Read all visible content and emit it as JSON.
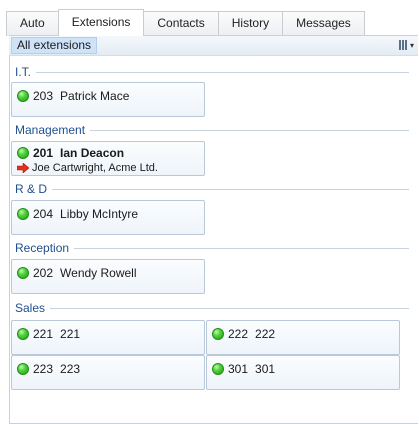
{
  "tabs": [
    {
      "label": "Auto",
      "active": false
    },
    {
      "label": "Extensions",
      "active": true
    },
    {
      "label": "Contacts",
      "active": false
    },
    {
      "label": "History",
      "active": false
    },
    {
      "label": "Messages",
      "active": false
    }
  ],
  "filter": {
    "label": "All extensions",
    "view_menu_icon": "column-view-icon"
  },
  "colors": {
    "group_title": "#1f4f8f",
    "status_available": "#3cc22c",
    "incoming_call_arrow": "#e0301e",
    "card_border": "#b9c9da",
    "filter_chip": "#cfe3f8"
  },
  "groups": [
    {
      "title": "I.T.",
      "extensions": [
        {
          "number": "203",
          "name": "Patrick Mace",
          "status": "available"
        }
      ]
    },
    {
      "title": "Management",
      "extensions": [
        {
          "number": "201",
          "name": "Ian Deacon",
          "status": "available",
          "call": "Joe Cartwright, Acme Ltd."
        }
      ]
    },
    {
      "title": "R & D",
      "extensions": [
        {
          "number": "204",
          "name": "Libby McIntyre",
          "status": "available"
        }
      ]
    },
    {
      "title": "Reception",
      "extensions": [
        {
          "number": "202",
          "name": "Wendy Rowell",
          "status": "available"
        }
      ]
    },
    {
      "title": "Sales",
      "extensions": [
        {
          "number": "221",
          "name": "221",
          "status": "available"
        },
        {
          "number": "222",
          "name": "222",
          "status": "available"
        },
        {
          "number": "223",
          "name": "223",
          "status": "available"
        },
        {
          "number": "301",
          "name": "301",
          "status": "available"
        }
      ]
    }
  ]
}
